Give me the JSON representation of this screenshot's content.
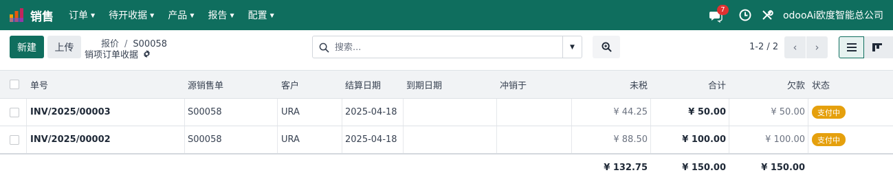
{
  "app": {
    "name": "销售",
    "menu": [
      "订单",
      "待开收据",
      "产品",
      "报告",
      "配置"
    ],
    "message_count": "7",
    "company": "odooAi欧度智能总公司"
  },
  "toolbar": {
    "new_label": "新建",
    "upload_label": "上传"
  },
  "breadcrumb": {
    "parent": "报价",
    "separator": "/",
    "current": "S00058"
  },
  "subtitle": "销项订单收据",
  "search": {
    "placeholder": "搜索..."
  },
  "pager": {
    "text": "1-2 / 2"
  },
  "table": {
    "columns": [
      "单号",
      "源销售单",
      "客户",
      "结算日期",
      "到期日期",
      "冲销于",
      "未税",
      "合计",
      "欠款",
      "状态"
    ],
    "rows": [
      {
        "number": "INV/2025/00003",
        "source": "S00058",
        "customer": "URA",
        "invoice_date": "2025-04-18",
        "due_date": "",
        "reversed": "",
        "untaxed": "¥ 44.25",
        "total": "¥ 50.00",
        "amount_due": "¥ 50.00",
        "status": "支付中"
      },
      {
        "number": "INV/2025/00002",
        "source": "S00058",
        "customer": "URA",
        "invoice_date": "2025-04-18",
        "due_date": "",
        "reversed": "",
        "untaxed": "¥ 88.50",
        "total": "¥ 100.00",
        "amount_due": "¥ 100.00",
        "status": "支付中"
      }
    ],
    "totals": {
      "untaxed": "¥ 132.75",
      "total": "¥ 150.00",
      "amount_due": "¥ 150.00"
    }
  },
  "colors": {
    "brand": "#0f6e5e",
    "badge": "#e03131",
    "status": "#e5a00d"
  },
  "icons": [
    "app-logo-icon",
    "chat-icon",
    "clock-icon",
    "tools-icon",
    "gear-icon",
    "search-icon",
    "zoom-icon",
    "list-view-icon",
    "kanban-view-icon"
  ]
}
